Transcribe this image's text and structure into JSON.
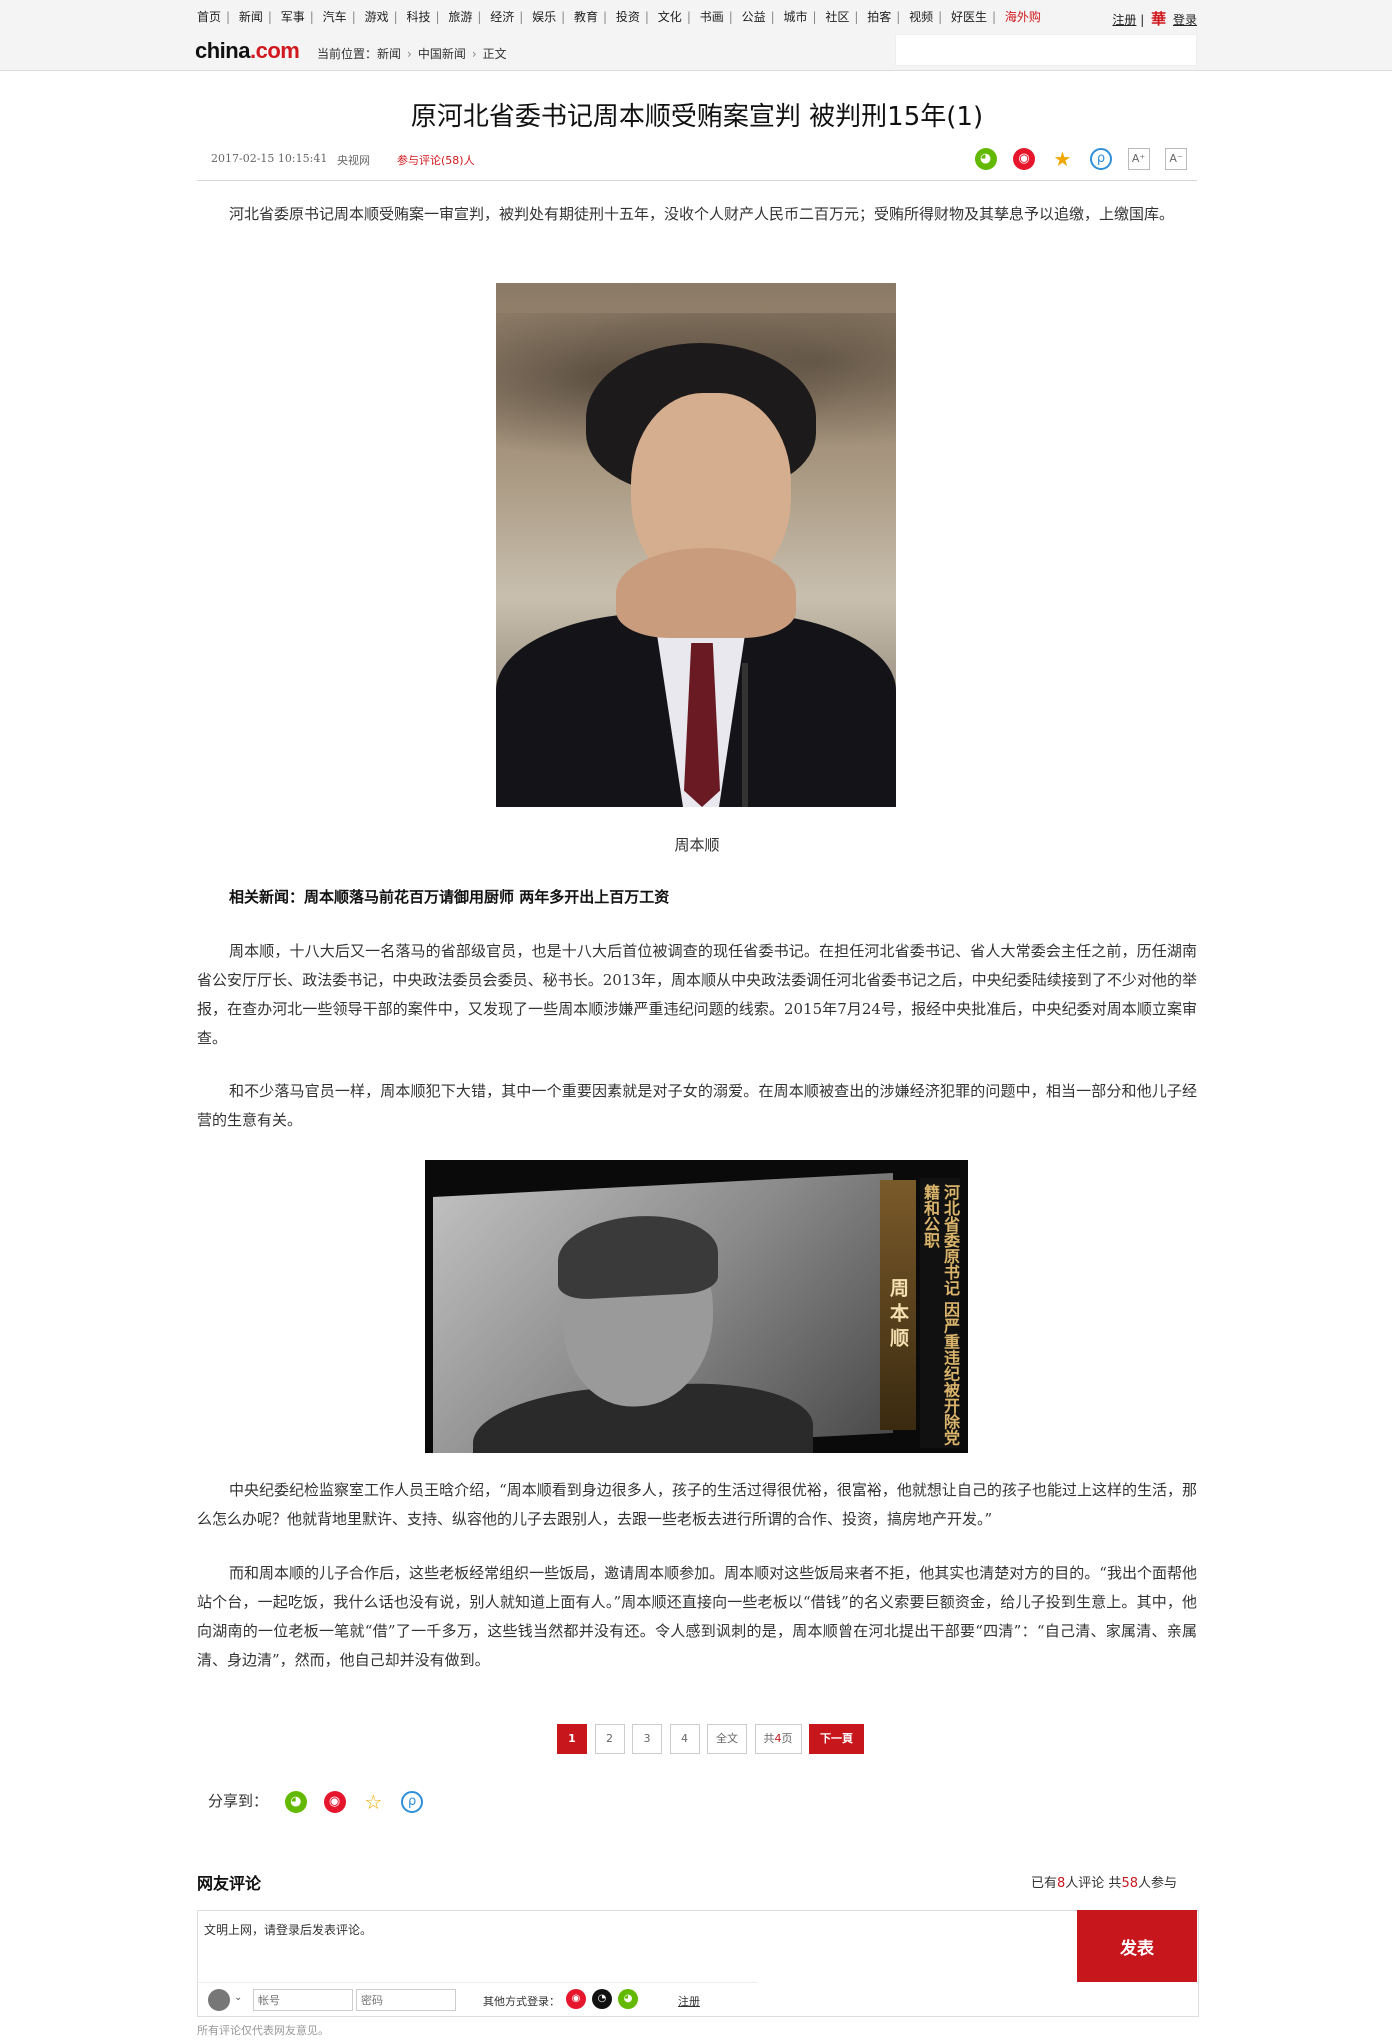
{
  "nav": {
    "links": [
      "首页",
      "新闻",
      "军事",
      "汽车",
      "游戏",
      "科技",
      "旅游",
      "经济",
      "娱乐",
      "教育",
      "投资",
      "文化",
      "书画",
      "公益",
      "城市",
      "社区",
      "拍客",
      "视频",
      "好医生"
    ],
    "hot_link": "海外购",
    "register": "注册",
    "divider": "|",
    "hua": "華",
    "login": "登录"
  },
  "logo": {
    "text": "china",
    "dot": ".",
    "suffix": "com"
  },
  "breadcrumb": {
    "label": "当前位置：",
    "items": [
      "新闻",
      "中国新闻",
      "正文"
    ]
  },
  "article": {
    "title": "原河北省委书记周本顺受贿案宣判 被判刑15年(1)",
    "time": "2017-02-15 10:15:41",
    "source": "央视网",
    "comment_link": "参与评论(58)人",
    "font_up": "A⁺",
    "font_down": "A⁻",
    "lead": "河北省委原书记周本顺受贿案一审宣判，被判处有期徒刑十五年，没收个人财产人民币二百万元；受贿所得财物及其孳息予以追缴，上缴国库。",
    "caption": "周本顺",
    "related": "相关新闻：周本顺落马前花百万请御用厨师  两年多开出上百万工资",
    "p1": "周本顺，十八大后又一名落马的省部级官员，也是十八大后首位被调查的现任省委书记。在担任河北省委书记、省人大常委会主任之前，历任湖南省公安厅厅长、政法委书记，中央政法委员会委员、秘书长。2013年，周本顺从中央政法委调任河北省委书记之后，中央纪委陆续接到了不少对他的举报，在查办河北一些领导干部的案件中，又发现了一些周本顺涉嫌严重违纪问题的线索。2015年7月24号，报经中央批准后，中央纪委对周本顺立案审查。",
    "p2": "和不少落马官员一样，周本顺犯下大错，其中一个重要因素就是对子女的溺爱。在周本顺被查出的涉嫌经济犯罪的问题中，相当一部分和他儿子经营的生意有关。",
    "video_name": "周本顺",
    "video_caption": "河北省委原书记 因严重违纪被开除党籍和公职",
    "p3": "中央纪委纪检监察室工作人员王晗介绍，“周本顺看到身边很多人，孩子的生活过得很优裕，很富裕，他就想让自己的孩子也能过上这样的生活，那么怎么办呢？他就背地里默许、支持、纵容他的儿子去跟别人，去跟一些老板去进行所谓的合作、投资，搞房地产开发。”",
    "p4": "而和周本顺的儿子合作后，这些老板经常组织一些饭局，邀请周本顺参加。周本顺对这些饭局来者不拒，他其实也清楚对方的目的。“我出个面帮他站个台，一起吃饭，我什么话也没有说，别人就知道上面有人。”周本顺还直接向一些老板以“借钱”的名义索要巨额资金，给儿子投到生意上。其中，他向湖南的一位老板一笔就“借”了一千多万，这些钱当然都并没有还。令人感到讽刺的是，周本顺曾在河北提出干部要“四清”：“自己清、家属清、亲属清、身边清”，然而，他自己却并没有做到。"
  },
  "pager": {
    "pages": [
      "1",
      "2",
      "3",
      "4"
    ],
    "current": "1",
    "all": "全文",
    "total_prefix": "共",
    "total": "4",
    "total_suffix": "页",
    "next": "下一頁"
  },
  "share": {
    "label": "分享到："
  },
  "comments": {
    "title": "网友评论",
    "stats_prefix": "已有",
    "count": "8",
    "stats_mid": "人评论  共",
    "participants": "58",
    "stats_suffix": "人参与",
    "textarea": "文明上网，请登录后发表评论。",
    "account_placeholder": "帐号",
    "password_placeholder": "密码",
    "other_login": "其他方式登录：",
    "register": "注册",
    "submit": "发表",
    "disclaimer": "所有评论仅代表网友意见。"
  },
  "colors": {
    "accent": "#c8161d",
    "wechat": "#62b900",
    "weibo": "#e6162d"
  }
}
